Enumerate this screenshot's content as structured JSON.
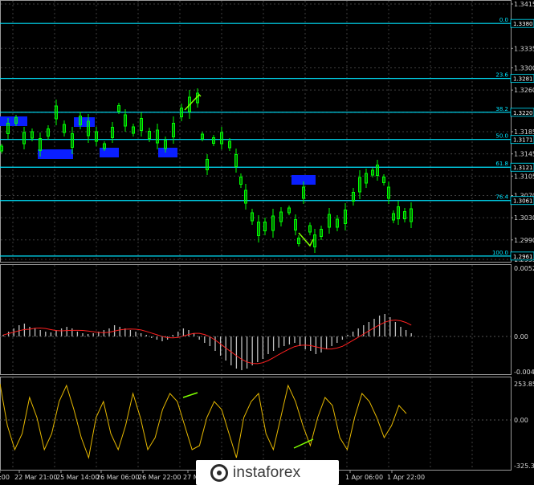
{
  "price_axis": {
    "ticks": [
      "1.3415",
      "1.3335",
      "1.3300",
      "1.3260",
      "1.3220",
      "1.3185",
      "1.3145",
      "1.3105",
      "1.3070",
      "1.3030",
      "1.2990",
      "1.2955"
    ]
  },
  "fib_levels": [
    {
      "label": "0.0",
      "value": "1.3380"
    },
    {
      "label": "23.6",
      "value": "1.3281"
    },
    {
      "label": "38.2",
      "value": "1.3220"
    },
    {
      "label": "50.0",
      "value": "1.3171"
    },
    {
      "label": "61.8",
      "value": "1.3121"
    },
    {
      "label": "76.4",
      "value": "1.3061"
    },
    {
      "label": "100.0",
      "value": "1.2961"
    }
  ],
  "macd_axis": {
    "top": "0.00528",
    "mid": "0.00",
    "bottom": "-0.0043"
  },
  "cci_axis": {
    "top": "253.8506",
    "mid": "0.00",
    "bottom": "-325.3427"
  },
  "time_axis": {
    "labels": [
      "0:00",
      "22 Mar 21:00",
      "25 Mar 14:00",
      "26 Mar 06:00",
      "26 Mar 22:00",
      "27 Ma",
      "1 Apr 06:00",
      "1 Apr 22:00"
    ]
  },
  "watermark": {
    "text": "instaforex"
  },
  "colors": {
    "background": "#000000",
    "candles": "#00ff00",
    "fib": "#00e5ff",
    "highlight": "#0000ff",
    "macd_hist": "#c0c0c0",
    "macd_signal": "#ff0000",
    "cci": "#ffd700",
    "divergence": "#7fff00"
  }
}
